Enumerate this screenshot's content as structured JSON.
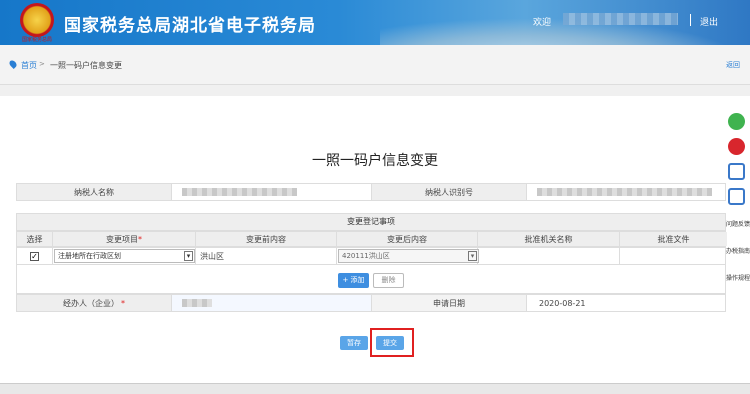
{
  "header": {
    "emblem_text": "国家税务总局",
    "title": "国家税务总局湖北省电子税务局",
    "welcome": "欢迎",
    "logout": "退出"
  },
  "breadcrumb": {
    "home": "首页",
    "separator": ">",
    "current": "一照一码户信息变更",
    "back": "返回"
  },
  "page_title": "一照一码户信息变更",
  "taxpayer": {
    "name_label": "纳税人名称",
    "id_label": "纳税人识别号"
  },
  "change_section": {
    "title": "变更登记事项",
    "headers": [
      "选择",
      "变更项目",
      "变更前内容",
      "变更后内容",
      "批准机关名称",
      "批准文件"
    ],
    "required_mark": "*",
    "row": {
      "checked": "✓",
      "item": "注册地所在行政区划",
      "before": "洪山区",
      "after": "420111洪山区",
      "approver": "",
      "document": ""
    }
  },
  "actions": {
    "add": "+ 添加",
    "delete": "删除"
  },
  "agent": {
    "label": "经办人（企业）",
    "required_mark": "*",
    "date_label": "申请日期",
    "date_value": "2020-08-21"
  },
  "buttons": {
    "save": "暂存",
    "submit": "提交"
  },
  "side_tools": {
    "feedback": "问题反馈",
    "guide": "办税指南",
    "manual": "操作规程"
  },
  "colors": {
    "header_blue": "#1677c9",
    "button_blue": "#5aa5e8",
    "highlight_red": "#e02020"
  }
}
